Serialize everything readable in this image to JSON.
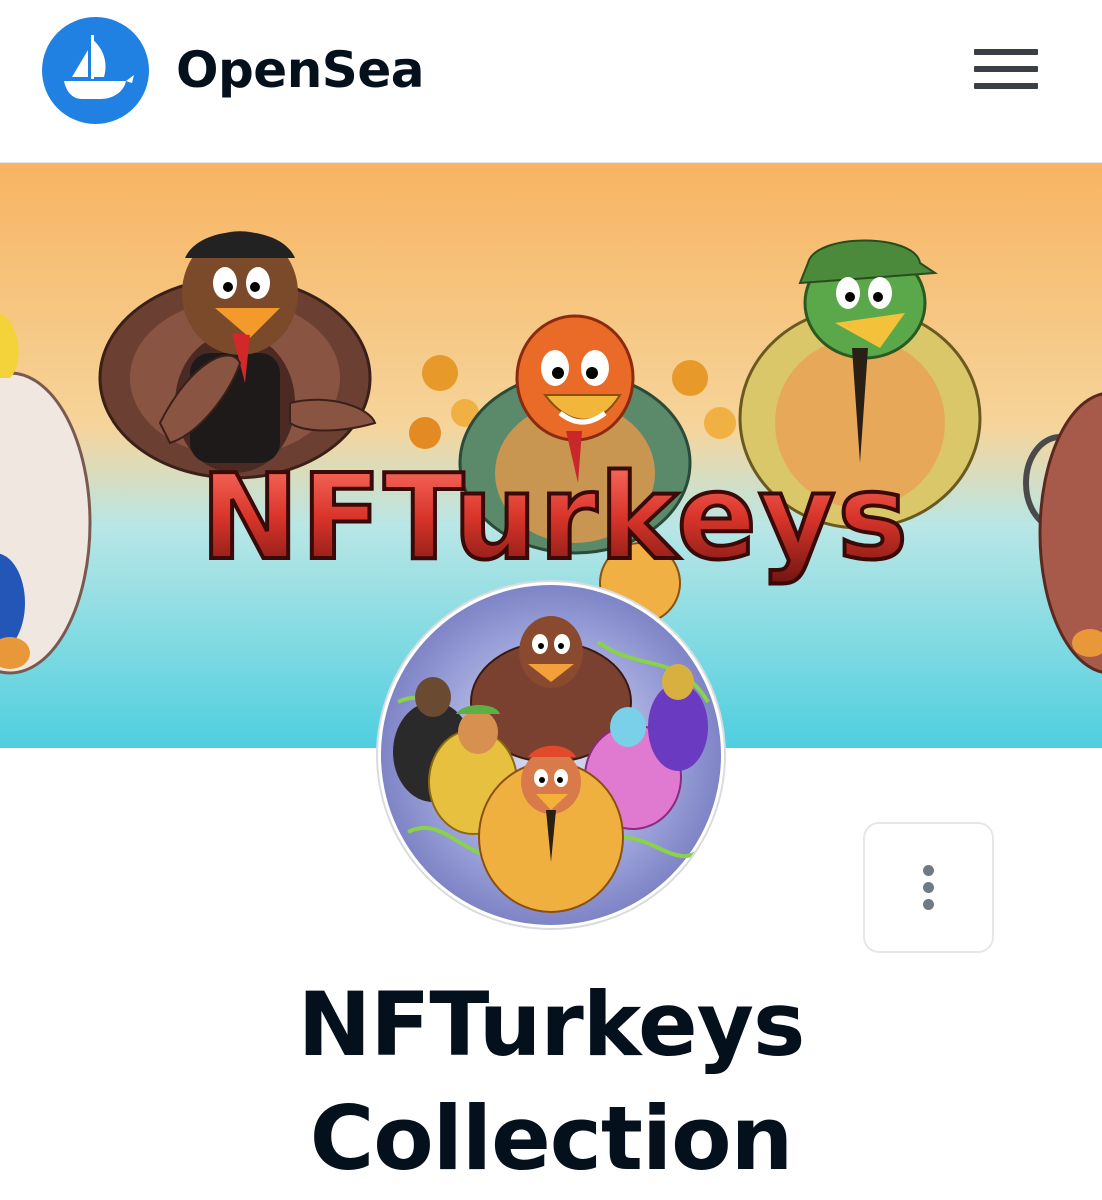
{
  "header": {
    "brand_name": "OpenSea",
    "logo_icon": "opensea-ship-icon",
    "menu_icon": "hamburger-menu-icon"
  },
  "banner": {
    "overlay_text": "NFTurkeys",
    "description": "collection-banner-image"
  },
  "avatar": {
    "description": "collection-avatar-image"
  },
  "more_button": {
    "icon": "vertical-ellipsis-icon"
  },
  "collection": {
    "title_line1": "NFTurkeys",
    "title_line2": "Collection"
  },
  "colors": {
    "brand_blue": "#2081e2",
    "text_dark": "#04111d",
    "menu_gray": "#3b3f45",
    "border_gray": "#e5e8eb",
    "dot_gray": "#707a83",
    "banner_top": "#f7b462",
    "banner_bottom": "#4ecfdf"
  }
}
